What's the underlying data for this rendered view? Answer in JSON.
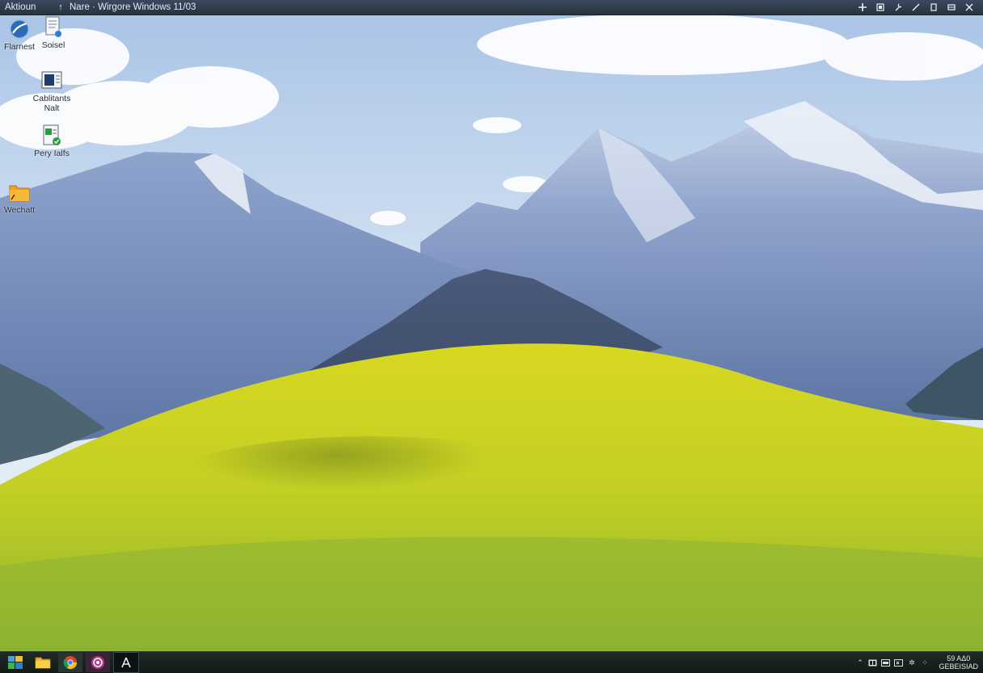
{
  "titlebar": {
    "app_name": "Aktioun",
    "up_arrow": "↑",
    "title": "Nare · Wirgore   Windows 11/03",
    "controls": [
      "pin",
      "restore-small",
      "wrench",
      "pen",
      "copy",
      "minimize",
      "close"
    ]
  },
  "desktop_icons": [
    {
      "label": "Flarnest",
      "icon": "browser-globe-icon"
    },
    {
      "label": "Soisel",
      "icon": "document-icon"
    },
    {
      "label": "Cablitants\nNalt",
      "icon": "monitor-document-icon"
    },
    {
      "label": "Pery Ialfs",
      "icon": "spreadsheet-icon"
    },
    {
      "label": "Wechatt",
      "icon": "folder-icon"
    }
  ],
  "taskbar": {
    "apps": [
      "start-icon",
      "file-explorer-icon",
      "chrome-icon",
      "media-app-icon",
      "terminal-icon"
    ],
    "tray_icons": [
      "arrow-icon",
      "battery-icon",
      "network-icon",
      "volume-icon",
      "settings-icon",
      "notification-icon"
    ],
    "clock_time": "59 ΑΔ0",
    "clock_date": "GEBEISIAD"
  },
  "colors": {
    "sky_top": "#b9cde8",
    "mountain": "#6d86b8",
    "hill": "#c9d42a",
    "taskbar": "#17201b"
  }
}
